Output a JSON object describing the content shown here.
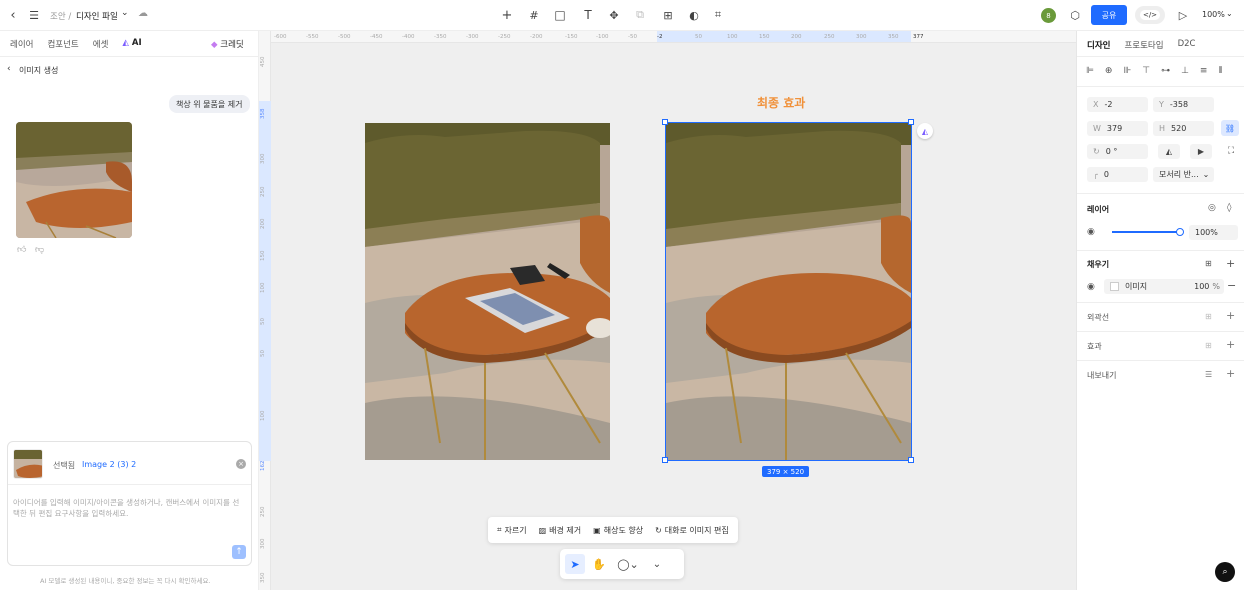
{
  "topbar": {
    "breadcrumb_parent": "조안 /",
    "file_name": "디자인 파일",
    "share_label": "공유",
    "zoom": "100%",
    "avatar_letter": "8"
  },
  "left_panel": {
    "tabs": [
      "레이어",
      "컴포넌트",
      "에셋"
    ],
    "ai_tab": "AI",
    "credit_label": "크레딧",
    "back_title": "이미지 생성",
    "user_message": "책상 위 물품을 제거",
    "selected_label": "선택됨",
    "selected_value": "Image 2 (3) 2",
    "prompt_placeholder": "아이디어를 입력해 이미지/아이콘을 생성하거나, 캔버스에서 이미지를 선택한 뒤 편집 요구사항을 입력하세요.",
    "disclaimer": "AI 모델로 생성된 내용이니, 중요한 정보는 꼭 다시 확인하세요."
  },
  "ruler": {
    "h_ticks": [
      "-600",
      "-550",
      "-500",
      "-450",
      "-400",
      "-350",
      "-300",
      "-250",
      "-200",
      "-150",
      "-100",
      "-50",
      "-2",
      "50",
      "100",
      "150",
      "200",
      "250",
      "300",
      "350",
      "377"
    ],
    "v_ticks": [
      "450",
      "358",
      "300",
      "250",
      "200",
      "150",
      "100",
      "50",
      "50",
      "100",
      "162",
      "250",
      "300",
      "350"
    ]
  },
  "canvas": {
    "result_title": "최종 효과",
    "size_badge": "379 × 520",
    "image_toolbar": [
      "자르기",
      "배경 제거",
      "해상도 향상",
      "대화로 이미지 편집"
    ]
  },
  "right_panel": {
    "tabs": [
      "디자인",
      "프로토타입",
      "D2C"
    ],
    "x": "-2",
    "y": "-358",
    "w": "379",
    "h": "520",
    "x_label": "X",
    "y_label": "Y",
    "w_label": "W",
    "h_label": "H",
    "rotation": "0 °",
    "corner": "0",
    "corner_mode": "모서리 반...",
    "layer_title": "레이어",
    "opacity": "100%",
    "fill_title": "채우기",
    "fill_type": "이미지",
    "fill_opacity": "100",
    "fill_pct": "%",
    "stroke_title": "외곽선",
    "effect_title": "효과",
    "export_title": "내보내기"
  },
  "colors": {
    "accent": "#1f6bff",
    "title_orange": "#f0913a"
  }
}
